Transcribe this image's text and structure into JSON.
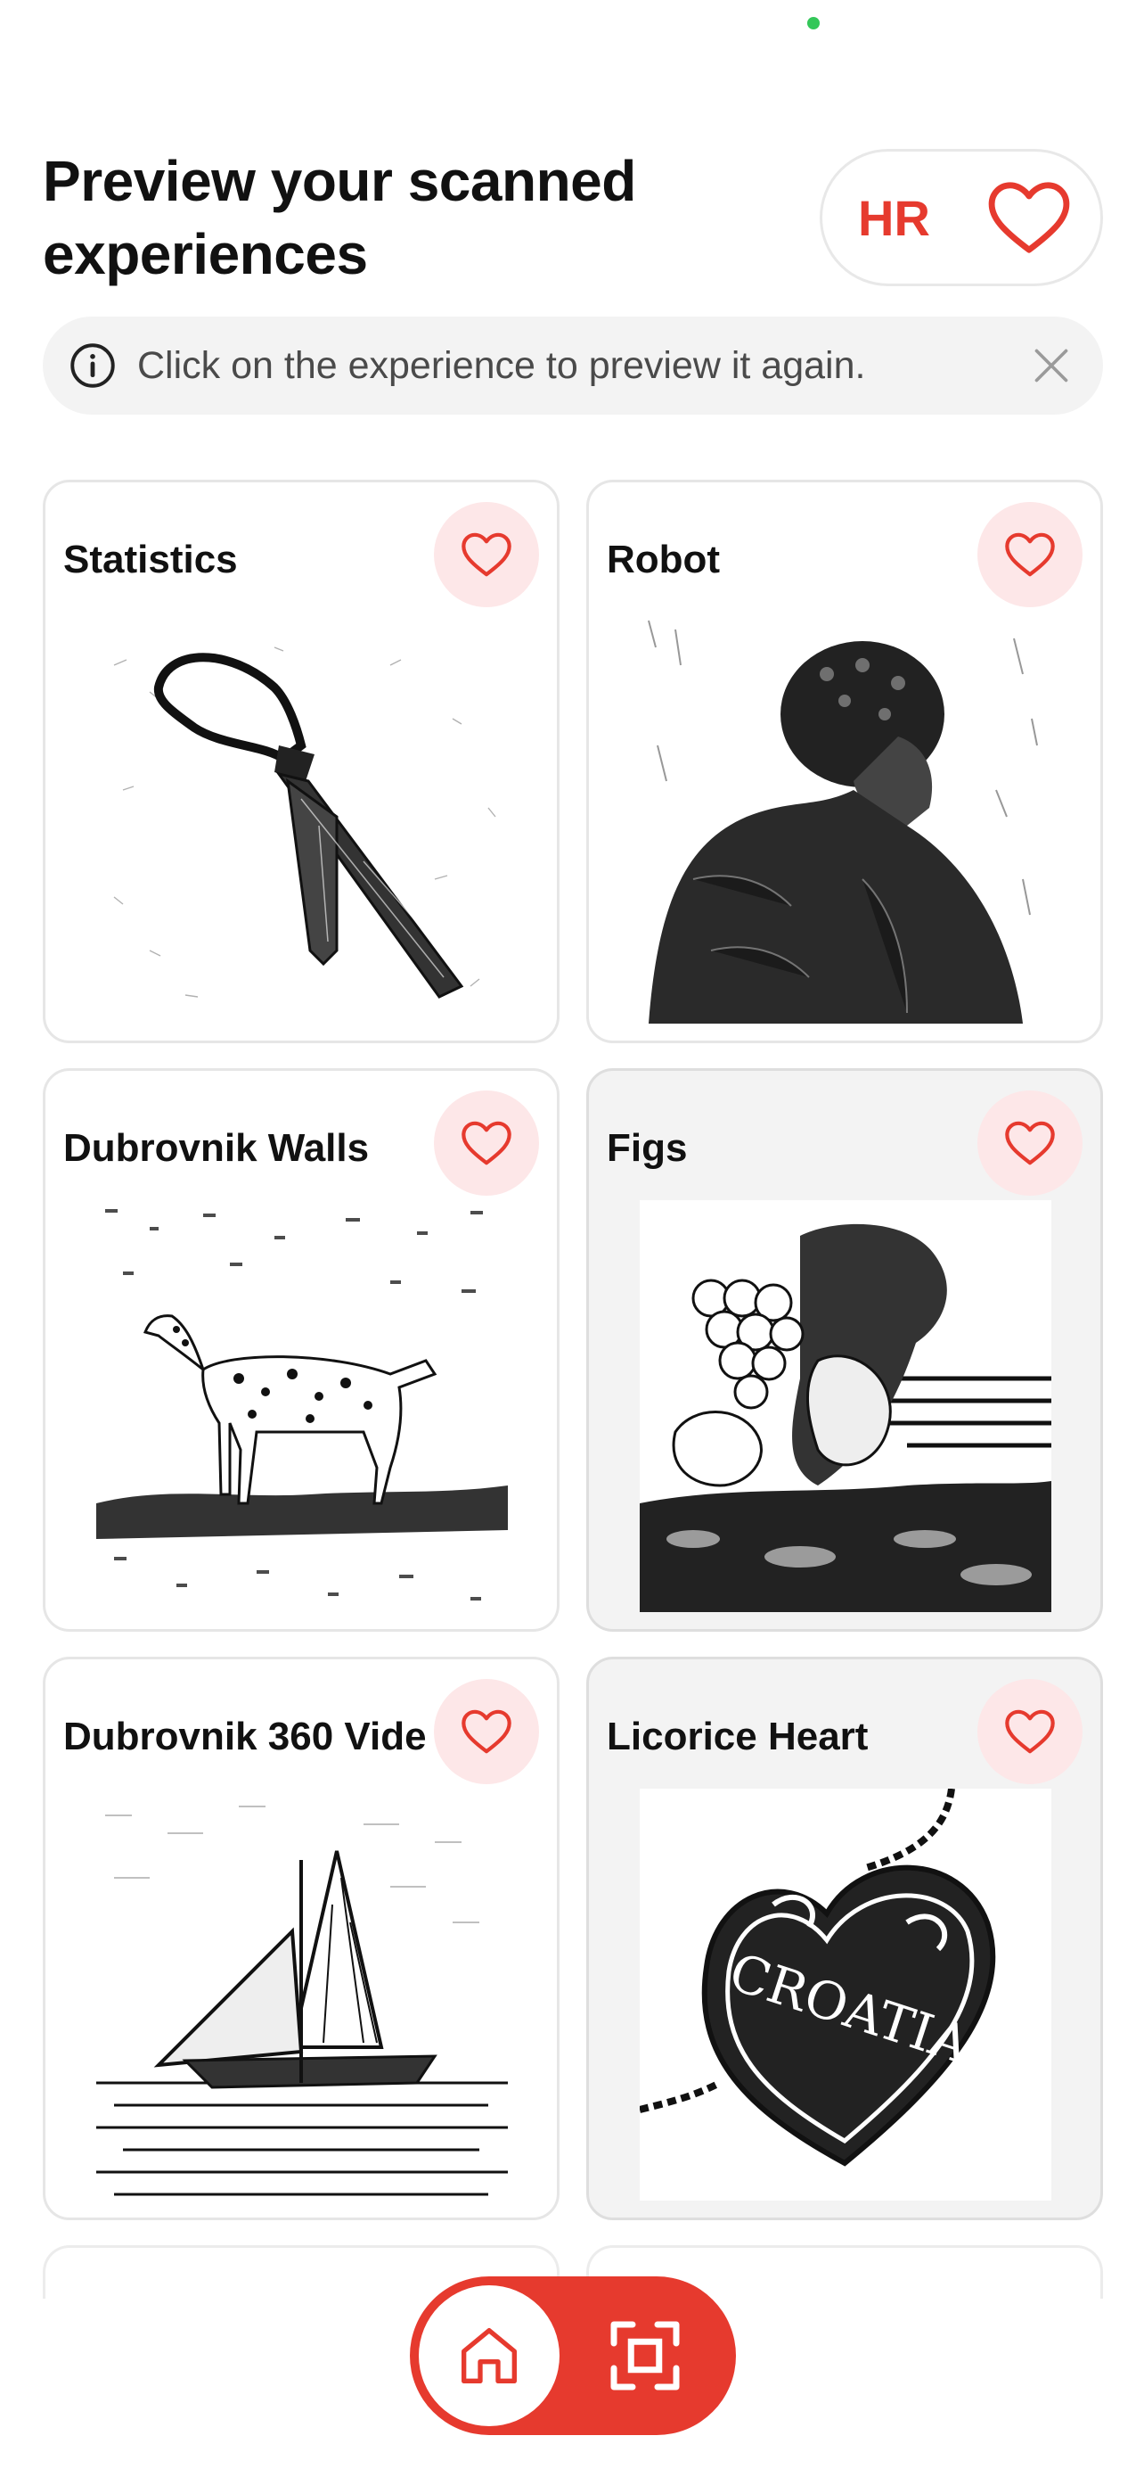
{
  "header": {
    "title": "Preview your scanned experiences",
    "language_label": "HR"
  },
  "info_banner": {
    "text": "Click on the experience to preview it again."
  },
  "cards": [
    {
      "title": "Statistics",
      "icon": "heart-outline-icon",
      "image": "tie-sketch"
    },
    {
      "title": "Robot",
      "icon": "heart-outline-icon",
      "image": "man-profile-sketch"
    },
    {
      "title": "Dubrovnik Walls",
      "icon": "heart-outline-icon",
      "image": "dalmatian-dog-sketch"
    },
    {
      "title": "Figs",
      "icon": "heart-outline-icon",
      "image": "grapes-vine-sketch"
    },
    {
      "title": "Dubrovnik 360 Vide",
      "icon": "heart-outline-icon",
      "image": "sailboat-sketch"
    },
    {
      "title": "Licorice Heart",
      "icon": "heart-outline-icon",
      "image": "croatia-heart-sketch"
    }
  ],
  "bottom_nav": {
    "items": [
      "home-icon",
      "scan-frame-icon"
    ]
  },
  "colors": {
    "accent": "#e63a2e",
    "fav_bg": "#fde7e8",
    "status_dot": "#34c759"
  }
}
